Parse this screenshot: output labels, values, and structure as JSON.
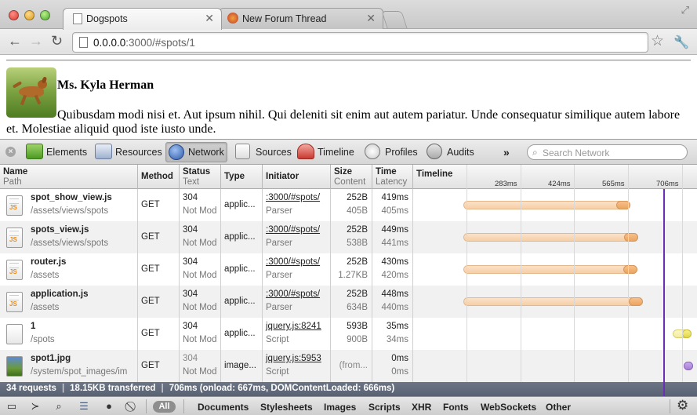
{
  "browser": {
    "tabs": [
      {
        "label": "Dogspots",
        "active": true
      },
      {
        "label": "New Forum Thread",
        "active": false
      }
    ],
    "url_host": "0.0.0.0",
    "url_rest": ":3000/#spots/1"
  },
  "page": {
    "user_name": "Ms. Kyla Herman",
    "bio": "Quibusdam modi nisi et. Aut ipsum nihil. Qui deleniti sit enim aut autem pariatur. Unde consequatur similique autem labore et. Molestiae aliquid quod iste iusto unde."
  },
  "devtools": {
    "panels": [
      "Elements",
      "Resources",
      "Network",
      "Sources",
      "Timeline",
      "Profiles",
      "Audits"
    ],
    "selected_panel": "Network",
    "more": "»",
    "search_placeholder": "Search Network"
  },
  "network": {
    "columns": {
      "name": "Name",
      "path": "Path",
      "method": "Method",
      "status": "Status",
      "text": "Text",
      "type": "Type",
      "initiator": "Initiator",
      "size": "Size",
      "content": "Content",
      "time": "Time",
      "latency": "Latency",
      "timeline": "Timeline"
    },
    "ticks": [
      "283ms",
      "424ms",
      "565ms",
      "706ms"
    ],
    "rows": [
      {
        "name": "spot_show_view.js",
        "path": "/assets/views/spots",
        "method": "GET",
        "status": "304",
        "status_text": "Not Mod",
        "type": "applic...",
        "initiator": ":3000/#spots/",
        "initiator_type": "Parser",
        "size": "252B",
        "content": "405B",
        "time": "419ms",
        "latency": "405ms",
        "icon": "js"
      },
      {
        "name": "spots_view.js",
        "path": "/assets/views/spots",
        "method": "GET",
        "status": "304",
        "status_text": "Not Mod",
        "type": "applic...",
        "initiator": ":3000/#spots/",
        "initiator_type": "Parser",
        "size": "252B",
        "content": "538B",
        "time": "449ms",
        "latency": "441ms",
        "icon": "js"
      },
      {
        "name": "router.js",
        "path": "/assets",
        "method": "GET",
        "status": "304",
        "status_text": "Not Mod",
        "type": "applic...",
        "initiator": ":3000/#spots/",
        "initiator_type": "Parser",
        "size": "252B",
        "content": "1.27KB",
        "time": "430ms",
        "latency": "420ms",
        "icon": "js"
      },
      {
        "name": "application.js",
        "path": "/assets",
        "method": "GET",
        "status": "304",
        "status_text": "Not Mod",
        "type": "applic...",
        "initiator": ":3000/#spots/",
        "initiator_type": "Parser",
        "size": "252B",
        "content": "634B",
        "time": "448ms",
        "latency": "440ms",
        "icon": "js"
      },
      {
        "name": "1",
        "path": "/spots",
        "method": "GET",
        "status": "304",
        "status_text": "Not Mod",
        "type": "applic...",
        "initiator": "jquery.js:8241",
        "initiator_type": "Script",
        "size": "593B",
        "content": "900B",
        "time": "35ms",
        "latency": "34ms",
        "icon": "doc"
      },
      {
        "name": "spot1.jpg",
        "path": "/system/spot_images/im",
        "method": "GET",
        "status": "304",
        "status_text": "Not Mod",
        "type": "image...",
        "initiator": "jquery.js:5953",
        "initiator_type": "Script",
        "size": "(from...",
        "content": "",
        "time": "0ms",
        "latency": "0ms",
        "icon": "img"
      }
    ],
    "summary": {
      "requests": "34 requests",
      "transferred": "18.15KB transferred",
      "timing": "706ms (onload: 667ms, DOMContentLoaded: 666ms)"
    }
  },
  "statusbar": {
    "all": "All",
    "filters": [
      "Documents",
      "Stylesheets",
      "Images",
      "Scripts",
      "XHR",
      "Fonts",
      "WebSockets",
      "Other"
    ]
  }
}
